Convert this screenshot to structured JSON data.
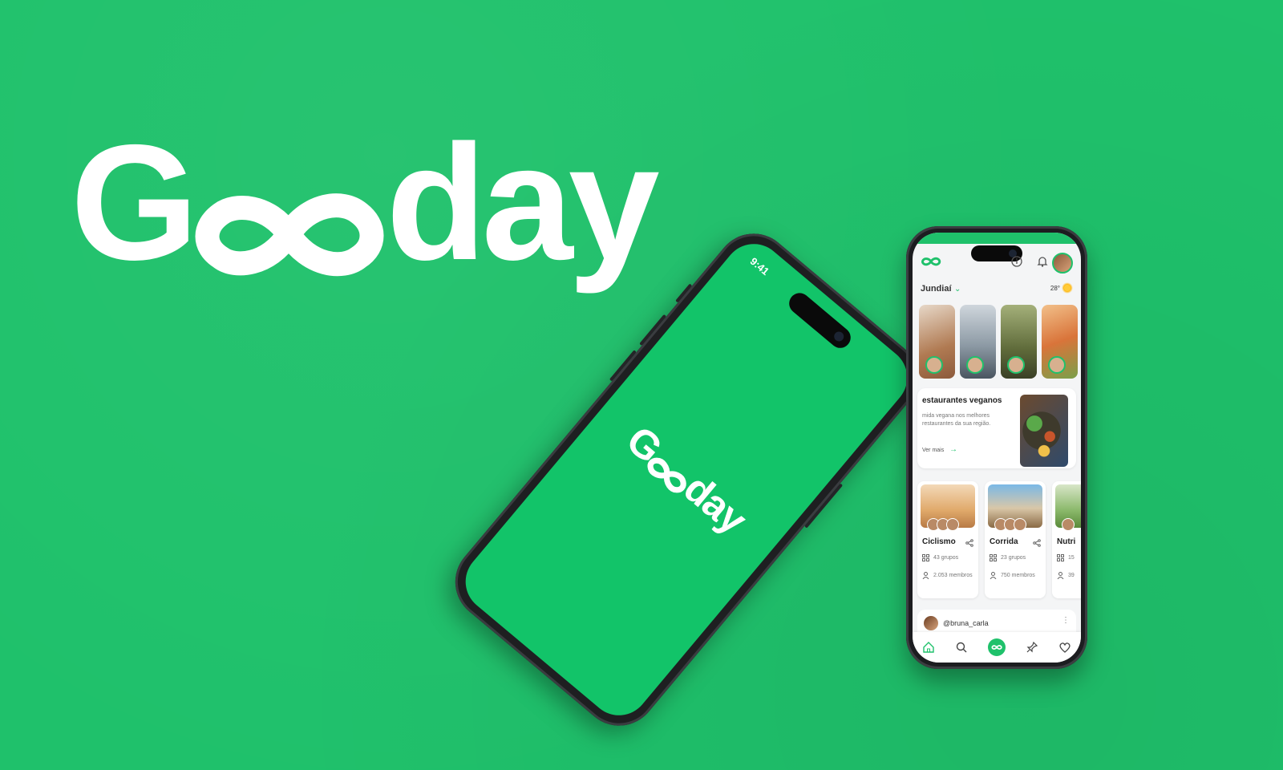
{
  "brand": {
    "name_prefix": "G",
    "name_suffix": "day",
    "background_color": "#1fc16b",
    "logo_color": "#ffffff"
  },
  "phone_tilted": {
    "status_time": "9:41",
    "logo_prefix": "G",
    "logo_suffix": "day"
  },
  "phone_app": {
    "location": "Jundiaí",
    "temperature": "28°",
    "weather_icon": "sun-icon",
    "header_icons": [
      "info-icon",
      "bell-icon"
    ],
    "featured_card": {
      "title": "estaurantes veganos",
      "description": "mida vegana nos melhores restaurantes da sua região.",
      "link_label": "Ver mais"
    },
    "groups": [
      {
        "name": "Ciclismo",
        "groups_count": "43 grupos",
        "members_count": "2.053 membros"
      },
      {
        "name": "Corrida",
        "groups_count": "23 grupos",
        "members_count": "750 membros"
      },
      {
        "name": "Nutri",
        "groups_count": "15",
        "members_count": "39"
      }
    ],
    "post": {
      "username": "@bruna_carla"
    },
    "tabbar": [
      "home-icon",
      "search-icon",
      "infinity-icon",
      "pin-icon",
      "heart-icon"
    ]
  }
}
